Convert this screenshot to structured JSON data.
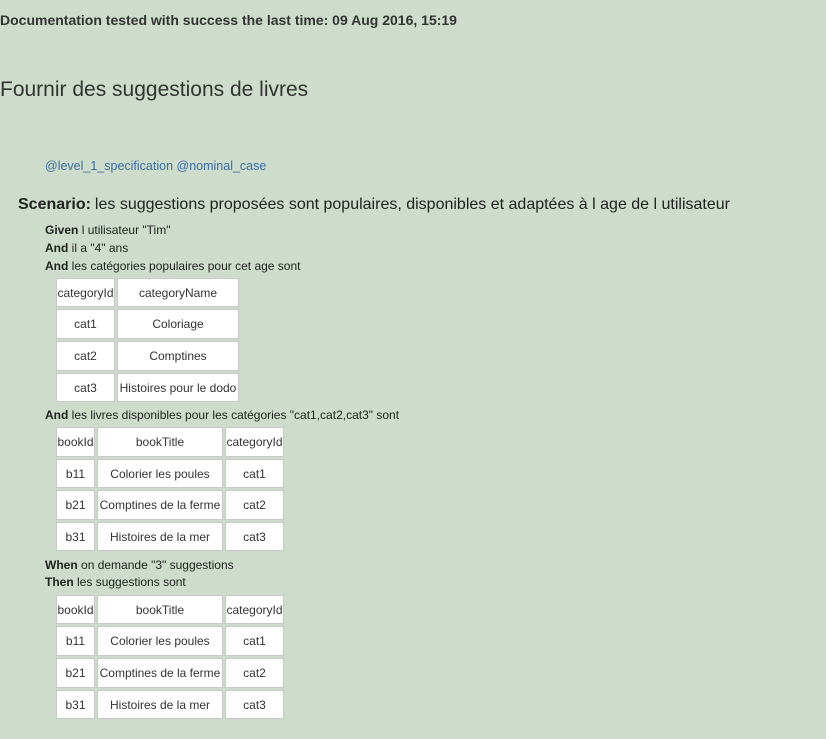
{
  "header": {
    "tested_line": "Documentation tested with success the last time: 09 Aug 2016, 15:19"
  },
  "feature": {
    "title": "Fournir des suggestions de livres"
  },
  "scenario": {
    "tags": "@level_1_specification @nominal_case",
    "keyword": "Scenario:",
    "title": "les suggestions proposées sont populaires, disponibles et adaptées à l age de l utilisateur",
    "steps": [
      {
        "keyword": "Given",
        "text": "l utilisateur \"Tim\""
      },
      {
        "keyword": "And",
        "text": "il a \"4\" ans"
      },
      {
        "keyword": "And",
        "text": "les catégories populaires pour cet age sont"
      },
      {
        "keyword": "And",
        "text": "les livres disponibles pour les catégories \"cat1,cat2,cat3\" sont"
      },
      {
        "keyword": "When",
        "text": "on demande \"3\" suggestions"
      },
      {
        "keyword": "Then",
        "text": "les suggestions sont"
      }
    ],
    "tables": {
      "categories": {
        "header": [
          "categoryId",
          "categoryName"
        ],
        "rows": [
          [
            "cat1",
            "Coloriage"
          ],
          [
            "cat2",
            "Comptines"
          ],
          [
            "cat3",
            "Histoires pour le dodo"
          ]
        ]
      },
      "books": {
        "header": [
          "bookId",
          "bookTitle",
          "categoryId"
        ],
        "rows": [
          [
            "b11",
            "Colorier les poules",
            "cat1"
          ],
          [
            "b21",
            "Comptines de la ferme",
            "cat2"
          ],
          [
            "b31",
            "Histoires de la mer",
            "cat3"
          ]
        ]
      },
      "suggestions": {
        "header": [
          "bookId",
          "bookTitle",
          "categoryId"
        ],
        "rows": [
          [
            "b11",
            "Colorier les poules",
            "cat1"
          ],
          [
            "b21",
            "Comptines de la ferme",
            "cat2"
          ],
          [
            "b31",
            "Histoires de la mer",
            "cat3"
          ]
        ]
      }
    }
  }
}
